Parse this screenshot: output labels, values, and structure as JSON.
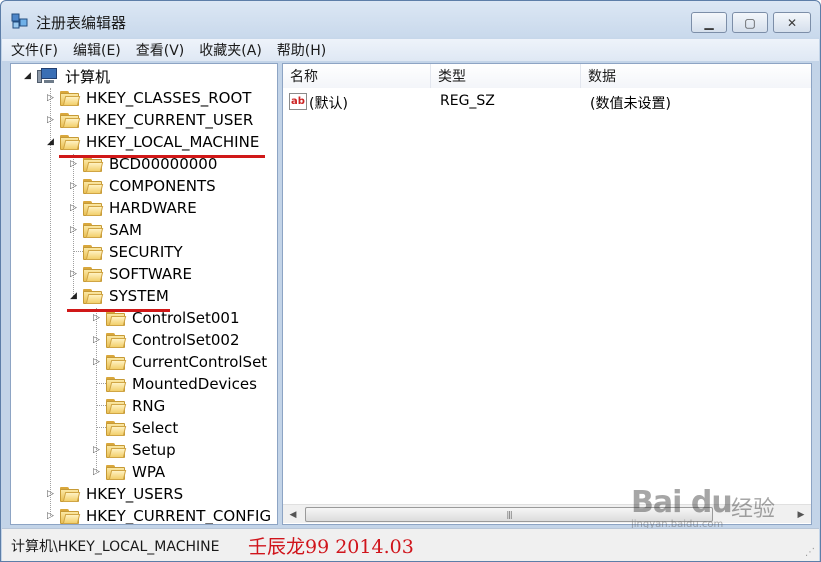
{
  "window": {
    "title": "注册表编辑器"
  },
  "menu": [
    "文件(F)",
    "编辑(E)",
    "查看(V)",
    "收藏夹(A)",
    "帮助(H)"
  ],
  "tree": {
    "root": "计算机",
    "items": [
      {
        "label": "HKEY_CLASSES_ROOT",
        "level": 1,
        "expander": "closed"
      },
      {
        "label": "HKEY_CURRENT_USER",
        "level": 1,
        "expander": "closed"
      },
      {
        "label": "HKEY_LOCAL_MACHINE",
        "level": 1,
        "expander": "open"
      },
      {
        "label": "BCD00000000",
        "level": 2,
        "expander": "closed"
      },
      {
        "label": "COMPONENTS",
        "level": 2,
        "expander": "closed"
      },
      {
        "label": "HARDWARE",
        "level": 2,
        "expander": "closed"
      },
      {
        "label": "SAM",
        "level": 2,
        "expander": "closed"
      },
      {
        "label": "SECURITY",
        "level": 2,
        "expander": "none"
      },
      {
        "label": "SOFTWARE",
        "level": 2,
        "expander": "closed"
      },
      {
        "label": "SYSTEM",
        "level": 2,
        "expander": "open"
      },
      {
        "label": "ControlSet001",
        "level": 3,
        "expander": "closed"
      },
      {
        "label": "ControlSet002",
        "level": 3,
        "expander": "closed"
      },
      {
        "label": "CurrentControlSet",
        "level": 3,
        "expander": "closed"
      },
      {
        "label": "MountedDevices",
        "level": 3,
        "expander": "none"
      },
      {
        "label": "RNG",
        "level": 3,
        "expander": "none"
      },
      {
        "label": "Select",
        "level": 3,
        "expander": "none"
      },
      {
        "label": "Setup",
        "level": 3,
        "expander": "closed"
      },
      {
        "label": "WPA",
        "level": 3,
        "expander": "closed"
      },
      {
        "label": "HKEY_USERS",
        "level": 1,
        "expander": "closed"
      },
      {
        "label": "HKEY_CURRENT_CONFIG",
        "level": 1,
        "expander": "closed"
      }
    ]
  },
  "list": {
    "columns": [
      "名称",
      "类型",
      "数据"
    ],
    "rows": [
      {
        "name": "(默认)",
        "type": "REG_SZ",
        "data": "(数值未设置)",
        "icon": "ab"
      }
    ]
  },
  "status": {
    "path": "计算机\\HKEY_LOCAL_MACHINE"
  },
  "signature": "壬辰龙99 2014.03",
  "watermark": {
    "logo": "Bai du",
    "text": "经验",
    "url": "jingyan.baidu.com"
  },
  "colors": {
    "highlight_underline": "#d01818",
    "signature": "#d0141b"
  }
}
